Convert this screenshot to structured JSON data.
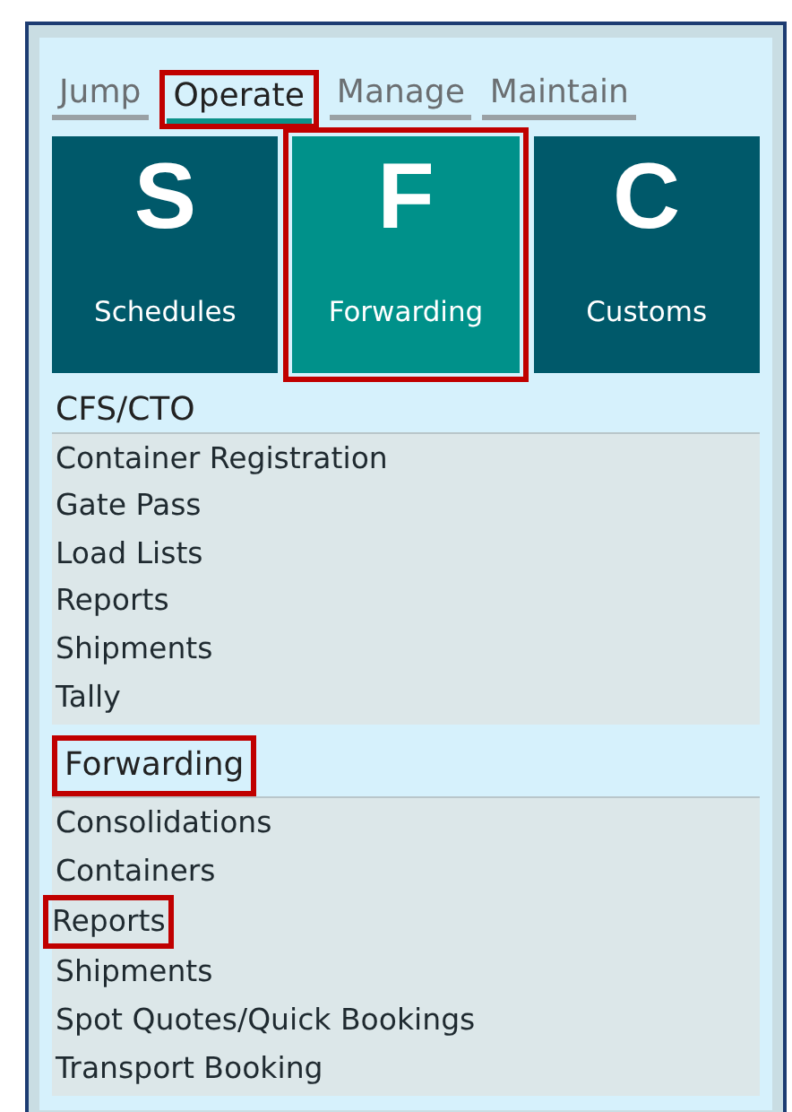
{
  "tabs": [
    {
      "label": "Jump",
      "selected": false,
      "highlighted": false
    },
    {
      "label": "Operate",
      "selected": true,
      "highlighted": true
    },
    {
      "label": "Manage",
      "selected": false,
      "highlighted": false
    },
    {
      "label": "Maintain",
      "selected": false,
      "highlighted": false
    }
  ],
  "tiles": [
    {
      "letter": "S",
      "label": "Schedules",
      "selected": false,
      "highlighted": false
    },
    {
      "letter": "F",
      "label": "Forwarding",
      "selected": true,
      "highlighted": true
    },
    {
      "letter": "C",
      "label": "Customs",
      "selected": false,
      "highlighted": false
    }
  ],
  "sections": [
    {
      "title": "CFS/CTO",
      "highlighted": false,
      "items": [
        {
          "label": "Container Registration",
          "highlighted": false
        },
        {
          "label": "Gate Pass",
          "highlighted": false
        },
        {
          "label": "Load Lists",
          "highlighted": false
        },
        {
          "label": "Reports",
          "highlighted": false
        },
        {
          "label": "Shipments",
          "highlighted": false
        },
        {
          "label": "Tally",
          "highlighted": false
        }
      ]
    },
    {
      "title": "Forwarding",
      "highlighted": true,
      "items": [
        {
          "label": "Consolidations",
          "highlighted": false
        },
        {
          "label": "Containers",
          "highlighted": false
        },
        {
          "label": "Reports",
          "highlighted": true
        },
        {
          "label": "Shipments",
          "highlighted": false
        },
        {
          "label": "Spot Quotes/Quick Bookings",
          "highlighted": false
        },
        {
          "label": "Transport Booking",
          "highlighted": false
        }
      ]
    }
  ]
}
